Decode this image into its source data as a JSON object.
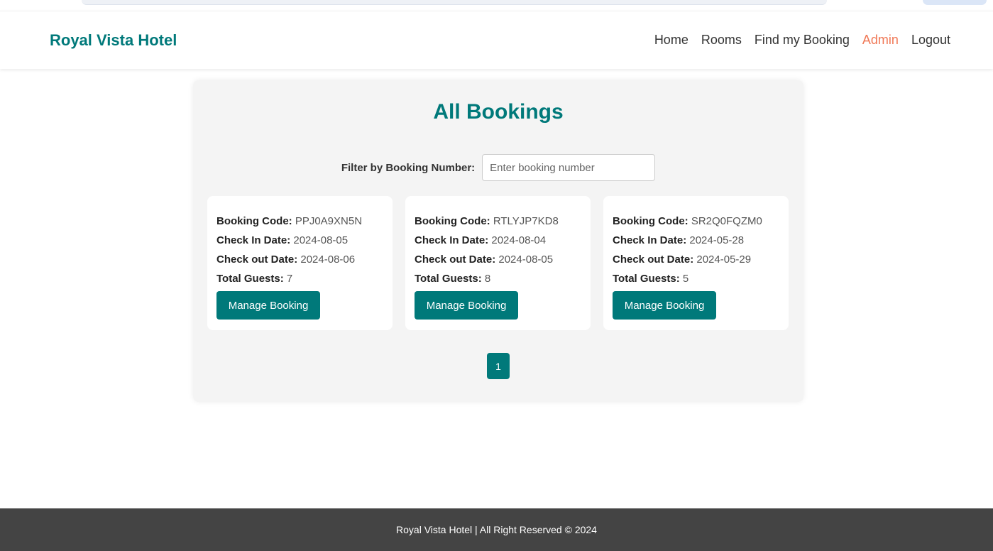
{
  "navbar": {
    "brand": "Royal Vista Hotel",
    "links": [
      {
        "label": "Home"
      },
      {
        "label": "Rooms"
      },
      {
        "label": "Find my Booking"
      },
      {
        "label": "Admin"
      },
      {
        "label": "Logout"
      }
    ],
    "active_link": "Admin"
  },
  "main": {
    "title": "All Bookings",
    "filter": {
      "label": "Filter by Booking Number:",
      "placeholder": "Enter booking number",
      "value": ""
    },
    "card_labels": {
      "code": "Booking Code:",
      "check_in": "Check In Date:",
      "check_out": "Check out Date:",
      "guests": "Total Guests:"
    },
    "bookings": [
      {
        "code": "PPJ0A9XN5N",
        "check_in": "2024-08-05",
        "check_out": "2024-08-06",
        "guests": "7",
        "button": "Manage Booking"
      },
      {
        "code": "RTLYJP7KD8",
        "check_in": "2024-08-04",
        "check_out": "2024-08-05",
        "guests": "8",
        "button": "Manage Booking"
      },
      {
        "code": "SR2Q0FQZM0",
        "check_in": "2024-05-28",
        "check_out": "2024-05-29",
        "guests": "5",
        "button": "Manage Booking"
      }
    ],
    "pagination": {
      "pages": [
        "1"
      ],
      "current": "1"
    }
  },
  "footer": {
    "text": "Royal Vista Hotel | All Right Reserved © 2024"
  },
  "colors": {
    "brand": "#00797a",
    "active_nav": "#f07856",
    "footer_bg": "#444444"
  }
}
